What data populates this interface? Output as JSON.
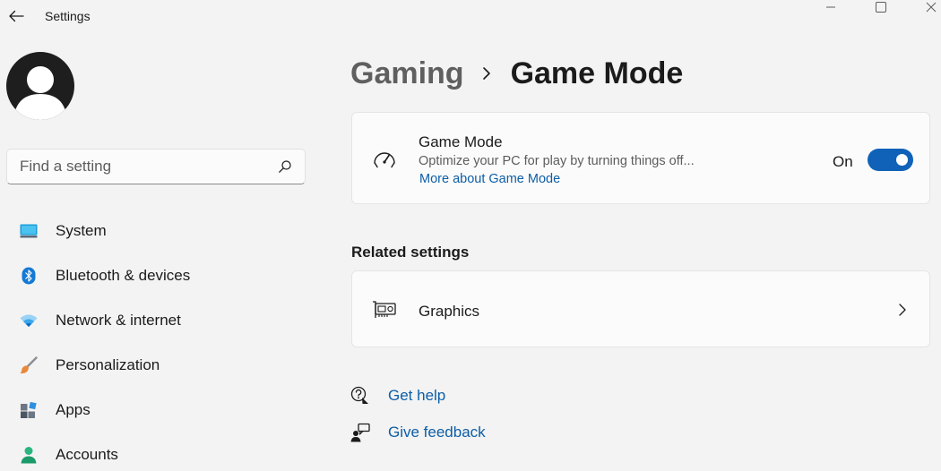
{
  "window": {
    "title": "Settings"
  },
  "search": {
    "placeholder": "Find a setting"
  },
  "sidebar": {
    "items": [
      {
        "label": "System",
        "icon": "system-icon"
      },
      {
        "label": "Bluetooth & devices",
        "icon": "bluetooth-icon"
      },
      {
        "label": "Network & internet",
        "icon": "wifi-icon"
      },
      {
        "label": "Personalization",
        "icon": "brush-icon"
      },
      {
        "label": "Apps",
        "icon": "apps-icon"
      },
      {
        "label": "Accounts",
        "icon": "accounts-icon"
      }
    ]
  },
  "breadcrumb": {
    "parent": "Gaming",
    "current": "Game Mode"
  },
  "game_mode": {
    "title": "Game Mode",
    "description": "Optimize your PC for play by turning things off...",
    "link": "More about Game Mode",
    "toggle_state": "On",
    "enabled": true,
    "icon": "gauge-icon"
  },
  "related": {
    "heading": "Related settings",
    "items": [
      {
        "label": "Graphics",
        "icon": "graphics-card-icon"
      }
    ]
  },
  "help": {
    "get_help": "Get help",
    "give_feedback": "Give feedback"
  },
  "colors": {
    "accent": "#0f62b8",
    "link": "#0d5ea6",
    "background": "#f3f3f3",
    "card": "#fbfbfb"
  }
}
